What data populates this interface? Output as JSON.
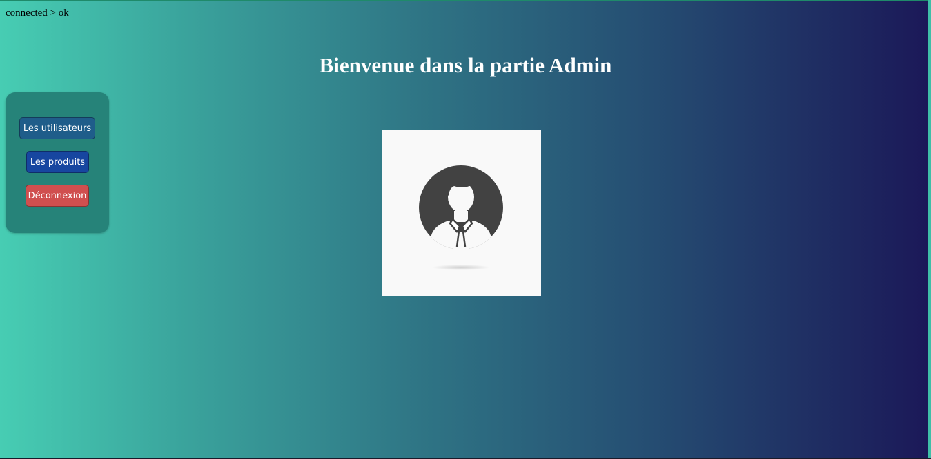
{
  "status_text": "connected > ok",
  "page_title": "Bienvenue dans la partie Admin",
  "sidebar": {
    "items": [
      {
        "label": "Les utilisateurs",
        "color": "#1f5d8a"
      },
      {
        "label": "Les produits",
        "color": "#1746a0"
      },
      {
        "label": "Déconnexion",
        "color": "#d04f4f"
      }
    ]
  },
  "avatar": {
    "icon": "user-avatar-icon",
    "circle_color": "#424242",
    "background": "#f9f9f9"
  },
  "colors": {
    "gradient_start": "#47cdb3",
    "gradient_end": "#1b1858",
    "sidebar_bg": "#268379"
  }
}
